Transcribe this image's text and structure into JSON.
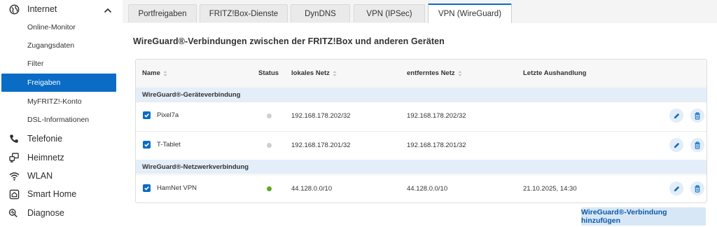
{
  "sidebar": {
    "internet_label": "Internet",
    "sub_items": [
      "Online-Monitor",
      "Zugangsdaten",
      "Filter",
      "Freigaben",
      "MyFRITZ!-Konto",
      "DSL-Informationen"
    ],
    "active_sub_item": "Freigaben",
    "main_items": [
      {
        "label": "Telefonie",
        "icon": "phone-icon"
      },
      {
        "label": "Heimnetz",
        "icon": "home-network-icon"
      },
      {
        "label": "WLAN",
        "icon": "wifi-icon"
      },
      {
        "label": "Smart Home",
        "icon": "smart-home-icon"
      },
      {
        "label": "Diagnose",
        "icon": "diagnose-icon"
      }
    ]
  },
  "tabs": [
    "Portfreigaben",
    "FRITZ!Box-Dienste",
    "DynDNS",
    "VPN (IPSec)",
    "VPN (WireGuard)"
  ],
  "active_tab": "VPN (WireGuard)",
  "heading": "WireGuard®-Verbindungen zwischen der FRITZ!Box und anderen Geräten",
  "table": {
    "columns": [
      "Name",
      "Status",
      "lokales Netz",
      "entferntes Netz",
      "Letzte Aushandlung"
    ],
    "groups": [
      {
        "title": "WireGuard®-Geräteverbindung",
        "rows": [
          {
            "name": "Pixel7a",
            "status": "inactive",
            "local": "192.168.178.202/32",
            "remote": "192.168.178.202/32",
            "last": ""
          },
          {
            "name": "T-Tablet",
            "status": "inactive",
            "local": "192.168.178.201/32",
            "remote": "192.168.178.201/32",
            "last": ""
          }
        ]
      },
      {
        "title": "WireGuard®-Netzwerkverbindung",
        "rows": [
          {
            "name": "HamNet VPN",
            "status": "active",
            "local": "44.128.0.0/10",
            "remote": "44.128.0.0/10",
            "last": "21.10.2025, 14:30"
          }
        ]
      }
    ]
  },
  "add_button_label": "WireGuard®-Verbindung hinzufügen",
  "colors": {
    "accent": "#0a6cc5",
    "status_active": "#5ea825",
    "status_inactive": "#cfcfcf",
    "group_bg": "#e4eef8"
  }
}
